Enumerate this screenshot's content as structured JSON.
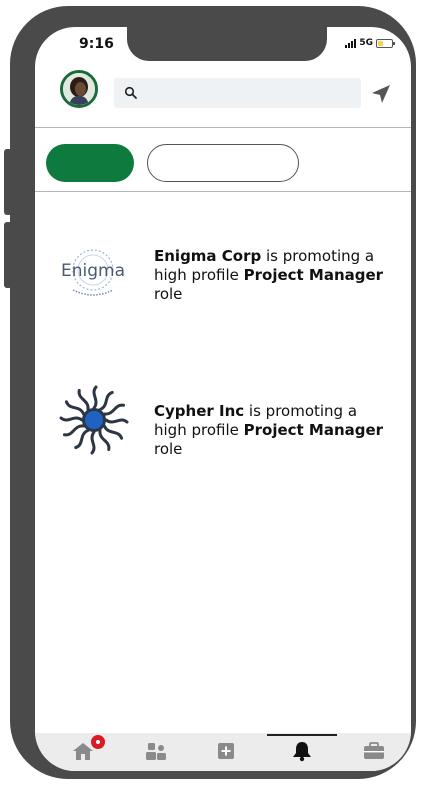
{
  "status_bar": {
    "time": "9:16",
    "network": "5G"
  },
  "search": {
    "value": "",
    "placeholder": ""
  },
  "tabs": [
    {
      "label": ""
    },
    {
      "label": ""
    }
  ],
  "notifications": [
    {
      "logo_text": "Enigma",
      "company": "Enigma Corp",
      "text_1": " is promoting a high profile ",
      "role": "Project Manager",
      "text_2": " role"
    },
    {
      "logo_text": "",
      "company": "Cypher Inc",
      "text_1": " is promoting a high profile ",
      "role": "Project Manager",
      "text_2": " role"
    }
  ],
  "bottom_nav": [
    {
      "icon": "home-icon",
      "active": false,
      "has_badge": true
    },
    {
      "icon": "network-icon",
      "active": false
    },
    {
      "icon": "add-post-icon",
      "active": false
    },
    {
      "icon": "notifications-bell-icon",
      "active": true
    },
    {
      "icon": "jobs-briefcase-icon",
      "active": false
    }
  ],
  "colors": {
    "accent": "#0e7a3e",
    "badge": "#d81b27",
    "frame": "#4a4a4a"
  }
}
